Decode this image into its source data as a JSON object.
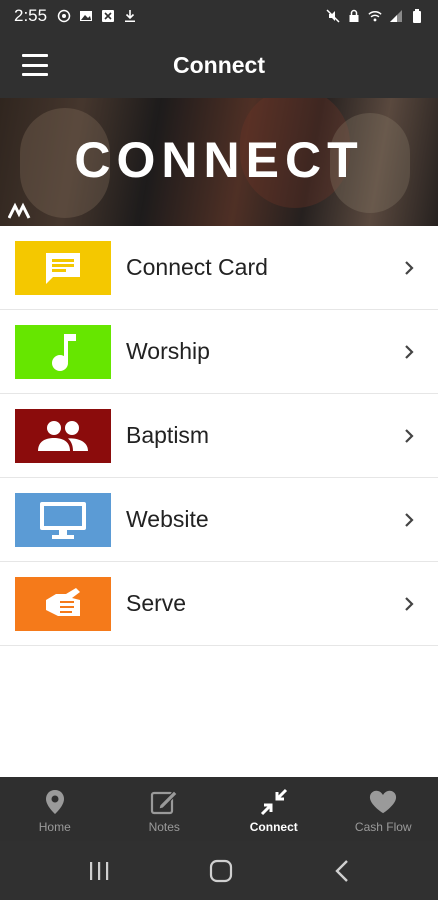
{
  "status_bar": {
    "time": "2:55",
    "left_icons": [
      "whatsapp-icon",
      "image-icon",
      "excel-icon",
      "download-icon"
    ],
    "right_icons": [
      "mute-icon",
      "lock-icon",
      "wifi-icon",
      "signal-icon",
      "battery-icon"
    ]
  },
  "app_bar": {
    "title": "Connect",
    "menu_icon": "hamburger-menu-icon"
  },
  "hero": {
    "title": "CONNECT",
    "logo": "church-logo"
  },
  "items": [
    {
      "label": "Connect Card",
      "icon": "message-icon",
      "color": "#f4c800"
    },
    {
      "label": "Worship",
      "icon": "music-note-icon",
      "color": "#66e600"
    },
    {
      "label": "Baptism",
      "icon": "people-icon",
      "color": "#8b0c0c"
    },
    {
      "label": "Website",
      "icon": "monitor-icon",
      "color": "#5b9bd5"
    },
    {
      "label": "Serve",
      "icon": "hand-icon",
      "color": "#f57a1a"
    }
  ],
  "tabs": [
    {
      "label": "Home",
      "icon": "location-pin-icon",
      "active": false
    },
    {
      "label": "Notes",
      "icon": "edit-icon",
      "active": false
    },
    {
      "label": "Connect",
      "icon": "compress-arrows-icon",
      "active": true
    },
    {
      "label": "Cash Flow",
      "icon": "heart-icon",
      "active": false
    }
  ],
  "nav_bar": {
    "buttons": [
      "recents-icon",
      "home-circle-icon",
      "back-icon"
    ]
  },
  "colors": {
    "bar": "#303030",
    "tab_active": "#ffffff",
    "tab_inactive": "#9a9a9a"
  }
}
